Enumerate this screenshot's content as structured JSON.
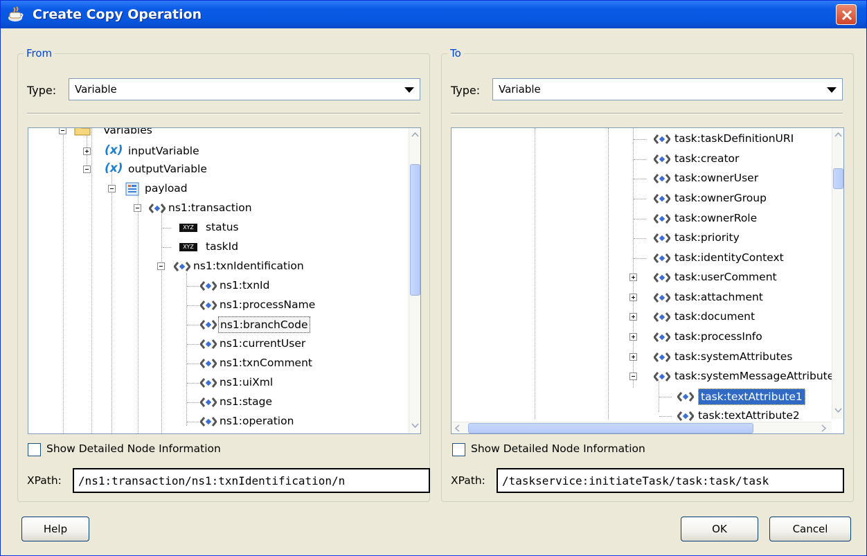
{
  "window": {
    "title": "Create Copy Operation"
  },
  "from": {
    "legend": "From",
    "type_label": "Type:",
    "type_value": "Variable",
    "tree": [
      {
        "label": "Variables",
        "icon": "folder-icon"
      },
      {
        "label": "inputVariable",
        "icon": "variable-icon"
      },
      {
        "label": "outputVariable",
        "icon": "variable-icon"
      },
      {
        "label": "payload",
        "icon": "message-part-icon"
      },
      {
        "label": "ns1:transaction",
        "icon": "element-icon"
      },
      {
        "label": "status",
        "icon": "xyz-icon"
      },
      {
        "label": "taskId",
        "icon": "xyz-icon"
      },
      {
        "label": "ns1:txnIdentification",
        "icon": "element-icon"
      },
      {
        "label": "ns1:txnId",
        "icon": "element-icon"
      },
      {
        "label": "ns1:processName",
        "icon": "element-icon"
      },
      {
        "label": "ns1:branchCode",
        "icon": "element-icon"
      },
      {
        "label": "ns1:currentUser",
        "icon": "element-icon"
      },
      {
        "label": "ns1:txnComment",
        "icon": "element-icon"
      },
      {
        "label": "ns1:uiXml",
        "icon": "element-icon"
      },
      {
        "label": "ns1:stage",
        "icon": "element-icon"
      },
      {
        "label": "ns1:operation",
        "icon": "element-icon"
      }
    ],
    "show_details_label": "Show Detailed Node Information",
    "xpath_label": "XPath:",
    "xpath_value": "/ns1:transaction/ns1:txnIdentification/n"
  },
  "to": {
    "legend": "To",
    "type_label": "Type:",
    "type_value": "Variable",
    "tree": [
      {
        "label": "task:taskDefinitionURI",
        "icon": "element-icon"
      },
      {
        "label": "task:creator",
        "icon": "element-icon"
      },
      {
        "label": "task:ownerUser",
        "icon": "element-icon"
      },
      {
        "label": "task:ownerGroup",
        "icon": "element-icon"
      },
      {
        "label": "task:ownerRole",
        "icon": "element-icon"
      },
      {
        "label": "task:priority",
        "icon": "element-icon"
      },
      {
        "label": "task:identityContext",
        "icon": "element-icon"
      },
      {
        "label": "task:userComment",
        "icon": "element-icon"
      },
      {
        "label": "task:attachment",
        "icon": "element-icon"
      },
      {
        "label": "task:document",
        "icon": "element-icon"
      },
      {
        "label": "task:processInfo",
        "icon": "element-icon"
      },
      {
        "label": "task:systemAttributes",
        "icon": "element-icon"
      },
      {
        "label": "task:systemMessageAttributes",
        "icon": "element-icon"
      },
      {
        "label": "task:textAttribute1",
        "icon": "element-icon"
      },
      {
        "label": "task:textAttribute2",
        "icon": "element-icon"
      }
    ],
    "show_details_label": "Show Detailed Node Information",
    "xpath_label": "XPath:",
    "xpath_value": "/taskservice:initiateTask/task:task/task"
  },
  "buttons": {
    "help": "Help",
    "ok": "OK",
    "cancel": "Cancel"
  },
  "colors": {
    "title_blue": "#0a5ae6",
    "legend_blue": "#0046d5",
    "selection": "#316ac5"
  }
}
